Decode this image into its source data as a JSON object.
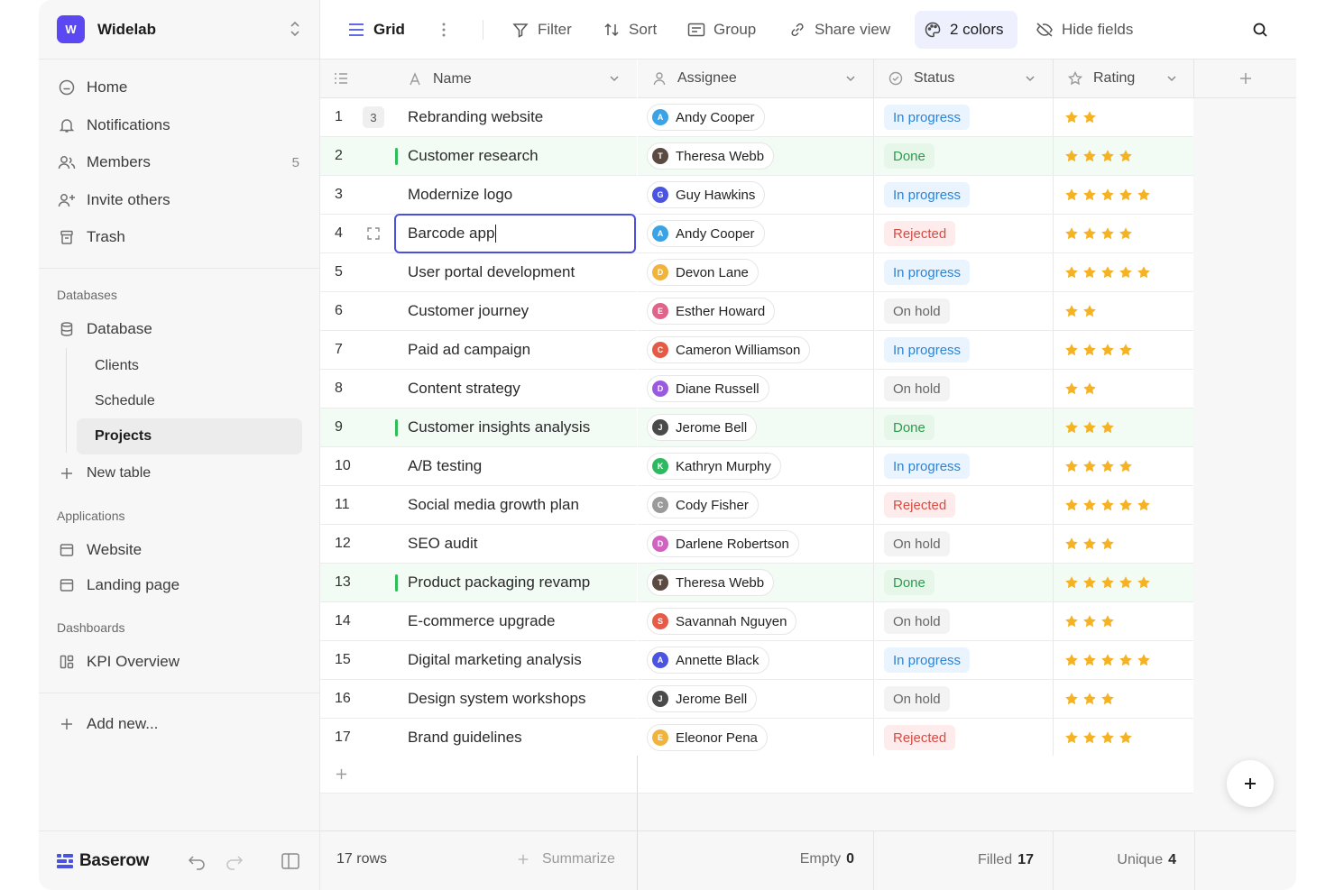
{
  "workspace": {
    "badge": "W",
    "name": "Widelab"
  },
  "nav": [
    {
      "label": "Home",
      "icon": "home-icon"
    },
    {
      "label": "Notifications",
      "icon": "bell-icon"
    },
    {
      "label": "Members",
      "icon": "members-icon",
      "count": "5"
    },
    {
      "label": "Invite others",
      "icon": "invite-icon"
    },
    {
      "label": "Trash",
      "icon": "trash-icon"
    }
  ],
  "sections": {
    "databases": "Databases",
    "database_label": "Database",
    "tables": [
      "Clients",
      "Schedule",
      "Projects"
    ],
    "active_table": "Projects",
    "new_table": "New table",
    "applications": "Applications",
    "apps": [
      "Website",
      "Landing page"
    ],
    "dashboards": "Dashboards",
    "dash_items": [
      "KPI Overview"
    ],
    "add_new": "Add new..."
  },
  "footer": {
    "brand": "Baserow"
  },
  "toolbar": {
    "view": "Grid",
    "filter": "Filter",
    "sort": "Sort",
    "group": "Group",
    "share": "Share view",
    "colors": "2 colors",
    "hide": "Hide fields"
  },
  "columns": {
    "name": "Name",
    "assignee": "Assignee",
    "status": "Status",
    "rating": "Rating"
  },
  "rows": [
    {
      "id": "1",
      "name": "Rebranding website",
      "assignee": "Andy Cooper",
      "initial": "A",
      "color": "#3aa3e6",
      "status": "In progress",
      "rating": 2,
      "comments": "3"
    },
    {
      "id": "2",
      "name": "Customer research",
      "assignee": "Theresa Webb",
      "initial": "T",
      "color": "#5a4a42",
      "status": "Done",
      "rating": 4,
      "highlight": true
    },
    {
      "id": "3",
      "name": "Modernize logo",
      "assignee": "Guy Hawkins",
      "initial": "G",
      "color": "#4b54e0",
      "status": "In progress",
      "rating": 5
    },
    {
      "id": "4",
      "name": "Barcode app",
      "assignee": "Andy Cooper",
      "initial": "A",
      "color": "#3aa3e6",
      "status": "Rejected",
      "rating": 4,
      "editing": true
    },
    {
      "id": "5",
      "name": "User portal development",
      "assignee": "Devon Lane",
      "initial": "D",
      "color": "#f0b43c",
      "status": "In progress",
      "rating": 5
    },
    {
      "id": "6",
      "name": "Customer journey",
      "assignee": "Esther Howard",
      "initial": "E",
      "color": "#e0648a",
      "status": "On hold",
      "rating": 2
    },
    {
      "id": "7",
      "name": "Paid ad campaign",
      "assignee": "Cameron Williamson",
      "initial": "C",
      "color": "#e55a45",
      "status": "In progress",
      "rating": 4
    },
    {
      "id": "8",
      "name": "Content strategy",
      "assignee": "Diane Russell",
      "initial": "D",
      "color": "#9a5ae0",
      "status": "On hold",
      "rating": 2
    },
    {
      "id": "9",
      "name": "Customer insights analysis",
      "assignee": "Jerome Bell",
      "initial": "J",
      "color": "#4a4a4a",
      "status": "Done",
      "rating": 3,
      "highlight": true
    },
    {
      "id": "10",
      "name": "A/B testing",
      "assignee": "Kathryn Murphy",
      "initial": "K",
      "color": "#2eb860",
      "status": "In progress",
      "rating": 4
    },
    {
      "id": "11",
      "name": "Social media growth plan",
      "assignee": "Cody Fisher",
      "initial": "C",
      "color": "#9a9a9a",
      "status": "Rejected",
      "rating": 5
    },
    {
      "id": "12",
      "name": "SEO audit",
      "assignee": "Darlene Robertson",
      "initial": "D",
      "color": "#d062c0",
      "status": "On hold",
      "rating": 3
    },
    {
      "id": "13",
      "name": "Product packaging revamp",
      "assignee": "Theresa Webb",
      "initial": "T",
      "color": "#5a4a42",
      "status": "Done",
      "rating": 5,
      "highlight": true
    },
    {
      "id": "14",
      "name": "E-commerce upgrade",
      "assignee": "Savannah Nguyen",
      "initial": "S",
      "color": "#e85a48",
      "status": "On hold",
      "rating": 3
    },
    {
      "id": "15",
      "name": "Digital marketing analysis",
      "assignee": "Annette Black",
      "initial": "A",
      "color": "#4b54e0",
      "status": "In progress",
      "rating": 5
    },
    {
      "id": "16",
      "name": "Design system workshops",
      "assignee": "Jerome Bell",
      "initial": "J",
      "color": "#4a4a4a",
      "status": "On hold",
      "rating": 3
    },
    {
      "id": "17",
      "name": "Brand guidelines",
      "assignee": "Eleonor Pena",
      "initial": "E",
      "color": "#f0b43c",
      "status": "Rejected",
      "rating": 4
    }
  ],
  "summary": {
    "rows": "17 rows",
    "summarize": "Summarize",
    "empty_label": "Empty",
    "empty_value": "0",
    "filled_label": "Filled",
    "filled_value": "17",
    "unique_label": "Unique",
    "unique_value": "4"
  },
  "colors": {
    "accent": "#5b48f2",
    "star": "#f5b324",
    "done_bar": "#2ebd59"
  }
}
